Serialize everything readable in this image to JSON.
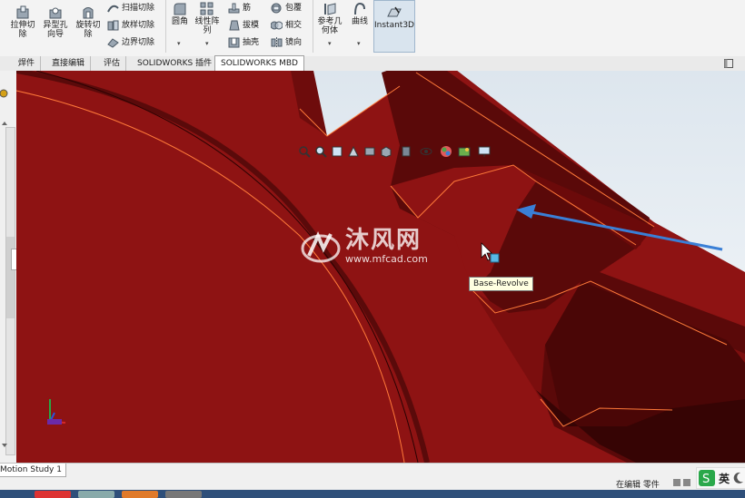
{
  "ribbon": {
    "cut_extrude": "拉伸切除",
    "hole_wizard": "异型孔向导",
    "revolve_cut": "旋转切除",
    "swept_cut": "扫描切除",
    "lofted_cut": "放样切除",
    "boundary_cut": "边界切除",
    "fillet": "圆角",
    "linear_pattern": "线性阵列",
    "rib": "筋",
    "draft": "拔模",
    "shell": "抽壳",
    "wrap": "包覆",
    "intersect": "相交",
    "mirror": "镜向",
    "ref_geometry": "参考几何体",
    "curves": "曲线",
    "instant3d": "Instant3D"
  },
  "tabs": [
    "焊件",
    "直接编辑",
    "评估",
    "SOLIDWORKS 插件",
    "SOLIDWORKS MBD"
  ],
  "viewport": {
    "tooltip": "Base-Revolve",
    "colors": {
      "gear_face": "#8c1212",
      "gear_dark": "#4a0606",
      "edge": "#ff7a3a",
      "arrow": "#3a7fd6"
    }
  },
  "watermark": {
    "title": "沐风网",
    "url": "www.mfcad.com"
  },
  "statusbar": {
    "motion_tab": "Motion Study 1",
    "status": "在编辑 零件"
  },
  "ime": {
    "label": "英"
  }
}
